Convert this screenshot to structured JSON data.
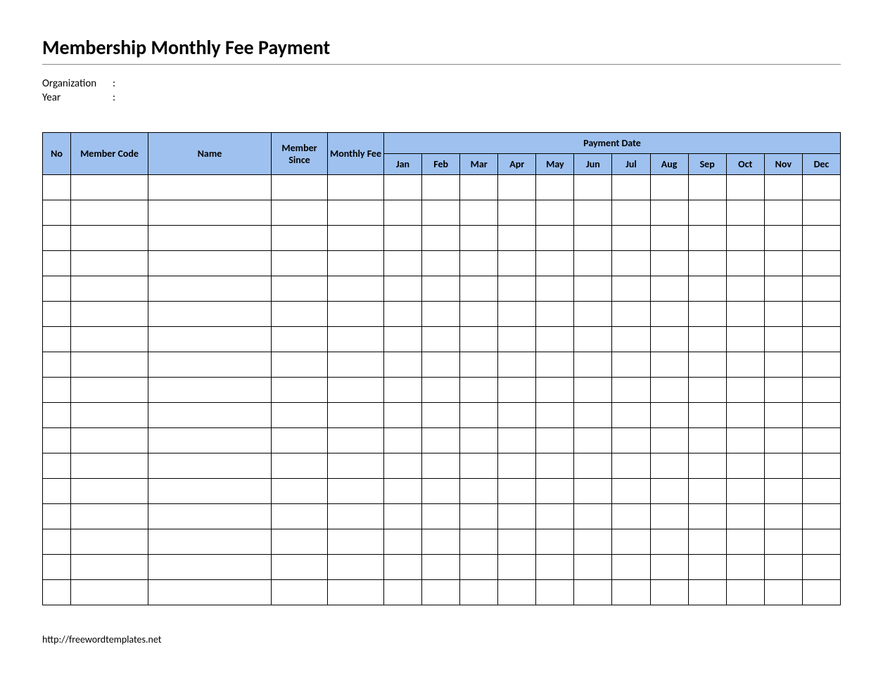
{
  "title": "Membership Monthly Fee Payment",
  "meta": {
    "organization_label": "Organization",
    "year_label": "Year",
    "colon": ":"
  },
  "headers": {
    "no": "No",
    "member_code": "Member Code",
    "name": "Name",
    "member_since": "Member Since",
    "monthly_fee": "Monthly Fee",
    "payment_date": "Payment Date",
    "months": [
      "Jan",
      "Feb",
      "Mar",
      "Apr",
      "May",
      "Jun",
      "Jul",
      "Aug",
      "Sep",
      "Oct",
      "Nov",
      "Dec"
    ]
  },
  "row_count": 17,
  "footer_url": "http://freewordtemplates.net"
}
